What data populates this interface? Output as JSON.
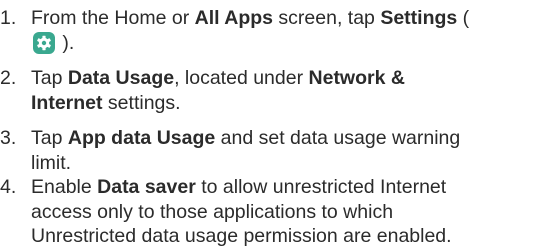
{
  "steps": [
    {
      "number": "1.",
      "line1": {
        "t1": "From the Home or ",
        "b1": "All Apps",
        "t2": " screen, tap ",
        "b2": "Settings",
        "t3": " ("
      },
      "line2": {
        "t1": " )."
      },
      "icon": "settings-gear-icon"
    },
    {
      "number": "2.",
      "line1": {
        "t1": "Tap ",
        "b1": "Data Usage",
        "t2": ", located under ",
        "b2": "Network &"
      },
      "line2": {
        "b1": "Internet",
        "t1": " settings."
      }
    },
    {
      "number": "3.",
      "line1": {
        "t1": "Tap ",
        "b1": "App data Usage",
        "t2": " and set data usage warning"
      },
      "line2": {
        "t1": "limit."
      }
    },
    {
      "number": "4.",
      "line1": {
        "t1": "Enable ",
        "b1": "Data saver",
        "t2": " to allow unrestricted Internet"
      },
      "line2": {
        "t1": "access only to those applications to which"
      },
      "line3": {
        "t1": "Unrestricted data usage permission are enabled."
      }
    }
  ],
  "colors": {
    "text": "#2b2b2b",
    "icon_bg": "#3aa88f",
    "icon_fg": "#ffffff"
  }
}
